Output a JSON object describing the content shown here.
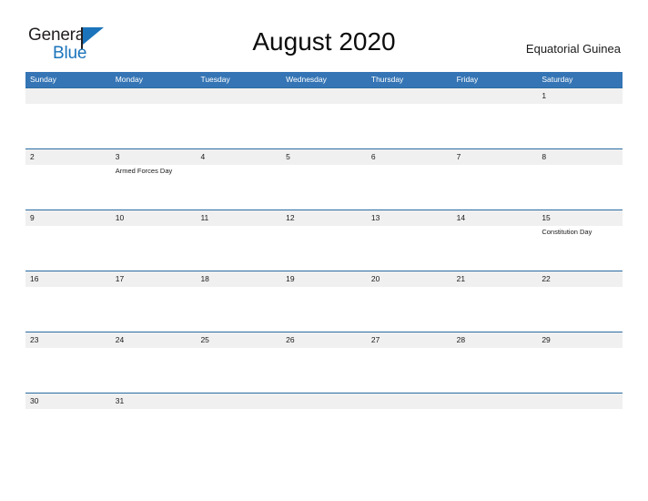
{
  "brand": {
    "name_part1": "General",
    "name_part2": "Blue",
    "flag_icon": "flag-triangle-icon"
  },
  "header": {
    "title": "August 2020",
    "subtitle": "Equatorial Guinea"
  },
  "colors": {
    "header_blue": "#3575b5",
    "rule_blue": "#2b6ca3",
    "band_gray": "#f0f0f0",
    "brand_blue": "#1b74bb",
    "text": "#1a1a1a"
  },
  "calendar": {
    "weekday_headers": [
      "Sunday",
      "Monday",
      "Tuesday",
      "Wednesday",
      "Thursday",
      "Friday",
      "Saturday"
    ],
    "weeks": [
      [
        {
          "day": "",
          "event": ""
        },
        {
          "day": "",
          "event": ""
        },
        {
          "day": "",
          "event": ""
        },
        {
          "day": "",
          "event": ""
        },
        {
          "day": "",
          "event": ""
        },
        {
          "day": "",
          "event": ""
        },
        {
          "day": "1",
          "event": ""
        }
      ],
      [
        {
          "day": "2",
          "event": ""
        },
        {
          "day": "3",
          "event": "Armed Forces Day"
        },
        {
          "day": "4",
          "event": ""
        },
        {
          "day": "5",
          "event": ""
        },
        {
          "day": "6",
          "event": ""
        },
        {
          "day": "7",
          "event": ""
        },
        {
          "day": "8",
          "event": ""
        }
      ],
      [
        {
          "day": "9",
          "event": ""
        },
        {
          "day": "10",
          "event": ""
        },
        {
          "day": "11",
          "event": ""
        },
        {
          "day": "12",
          "event": ""
        },
        {
          "day": "13",
          "event": ""
        },
        {
          "day": "14",
          "event": ""
        },
        {
          "day": "15",
          "event": "Constitution Day"
        }
      ],
      [
        {
          "day": "16",
          "event": ""
        },
        {
          "day": "17",
          "event": ""
        },
        {
          "day": "18",
          "event": ""
        },
        {
          "day": "19",
          "event": ""
        },
        {
          "day": "20",
          "event": ""
        },
        {
          "day": "21",
          "event": ""
        },
        {
          "day": "22",
          "event": ""
        }
      ],
      [
        {
          "day": "23",
          "event": ""
        },
        {
          "day": "24",
          "event": ""
        },
        {
          "day": "25",
          "event": ""
        },
        {
          "day": "26",
          "event": ""
        },
        {
          "day": "27",
          "event": ""
        },
        {
          "day": "28",
          "event": ""
        },
        {
          "day": "29",
          "event": ""
        }
      ],
      [
        {
          "day": "30",
          "event": ""
        },
        {
          "day": "31",
          "event": ""
        },
        {
          "day": "",
          "event": ""
        },
        {
          "day": "",
          "event": ""
        },
        {
          "day": "",
          "event": ""
        },
        {
          "day": "",
          "event": ""
        },
        {
          "day": "",
          "event": ""
        }
      ]
    ]
  }
}
